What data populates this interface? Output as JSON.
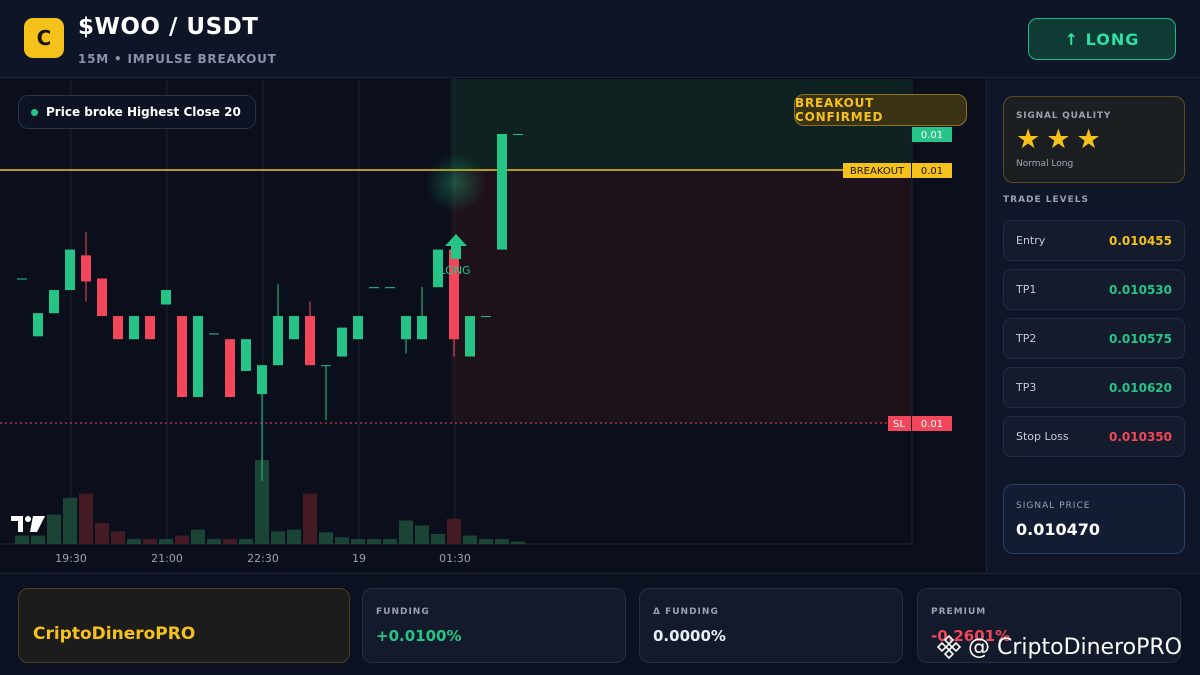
{
  "header": {
    "logo_letter": "C",
    "pair": "$WOO / USDT",
    "subtitle": "15M • IMPULSE BREAKOUT",
    "direction_icon": "arrow-up-icon",
    "direction_label": "↑ LONG"
  },
  "chart": {
    "info_pill": "Price broke Highest Close 20",
    "confirm_badge": "BREAKOUT CONFIRMED",
    "price_tags": {
      "current": "0.01",
      "breakout_label": "BREAKOUT",
      "breakout_value": "0.01",
      "sl_label": "SL",
      "sl_value": "0.01"
    },
    "signal_marker_label": "LONG",
    "x_ticks": [
      "19:30",
      "21:00",
      "22:30",
      "19",
      "01:30"
    ],
    "colors": {
      "up": "#26c486",
      "down": "#f2475a",
      "breakout": "#f5c21b",
      "stoploss": "#f2475a"
    }
  },
  "chart_data": {
    "type": "candlestick",
    "x_ticks": [
      "19:30",
      "21:00",
      "22:30",
      "19",
      "01:30"
    ],
    "levels": {
      "breakout": 0.01,
      "stop_loss": 0.01,
      "last": 0.01
    },
    "candles": [
      {
        "o": 0.5,
        "c": 0.5,
        "h": 0.5,
        "l": 0.5
      },
      {
        "o": 0.3,
        "c": 0.38,
        "h": 0.38,
        "l": 0.3
      },
      {
        "o": 0.38,
        "c": 0.46,
        "h": 0.46,
        "l": 0.38
      },
      {
        "o": 0.46,
        "c": 0.6,
        "h": 0.6,
        "l": 0.46
      },
      {
        "o": 0.58,
        "c": 0.49,
        "h": 0.66,
        "l": 0.42
      },
      {
        "o": 0.5,
        "c": 0.37,
        "h": 0.5,
        "l": 0.37
      },
      {
        "o": 0.37,
        "c": 0.29,
        "h": 0.37,
        "l": 0.29
      },
      {
        "o": 0.29,
        "c": 0.37,
        "h": 0.37,
        "l": 0.29
      },
      {
        "o": 0.37,
        "c": 0.29,
        "h": 0.37,
        "l": 0.29
      },
      {
        "o": 0.41,
        "c": 0.46,
        "h": 0.46,
        "l": 0.41
      },
      {
        "o": 0.37,
        "c": 0.09,
        "h": 0.37,
        "l": 0.09
      },
      {
        "o": 0.09,
        "c": 0.37,
        "h": 0.37,
        "l": 0.09
      },
      {
        "o": 0.31,
        "c": 0.31,
        "h": 0.31,
        "l": 0.31
      },
      {
        "o": 0.29,
        "c": 0.09,
        "h": 0.29,
        "l": 0.09
      },
      {
        "o": 0.18,
        "c": 0.29,
        "h": 0.29,
        "l": 0.18
      },
      {
        "o": 0.1,
        "c": 0.2,
        "h": 0.2,
        "l": -0.2
      },
      {
        "o": 0.2,
        "c": 0.37,
        "h": 0.48,
        "l": 0.2
      },
      {
        "o": 0.29,
        "c": 0.37,
        "h": 0.37,
        "l": 0.29
      },
      {
        "o": 0.37,
        "c": 0.2,
        "h": 0.42,
        "l": 0.2
      },
      {
        "o": 0.2,
        "c": 0.2,
        "h": 0.2,
        "l": 0.01
      },
      {
        "o": 0.23,
        "c": 0.33,
        "h": 0.33,
        "l": 0.23
      },
      {
        "o": 0.29,
        "c": 0.37,
        "h": 0.37,
        "l": 0.29
      },
      {
        "o": 0.47,
        "c": 0.47,
        "h": 0.47,
        "l": 0.47
      },
      {
        "o": 0.47,
        "c": 0.47,
        "h": 0.47,
        "l": 0.47
      },
      {
        "o": 0.29,
        "c": 0.37,
        "h": 0.37,
        "l": 0.24
      },
      {
        "o": 0.29,
        "c": 0.37,
        "h": 0.47,
        "l": 0.29
      },
      {
        "o": 0.47,
        "c": 0.6,
        "h": 0.6,
        "l": 0.47
      },
      {
        "o": 0.6,
        "c": 0.29,
        "h": 0.6,
        "l": 0.23
      },
      {
        "o": 0.23,
        "c": 0.37,
        "h": 0.37,
        "l": 0.23
      },
      {
        "o": 0.37,
        "c": 0.37,
        "h": 0.37,
        "l": 0.37
      },
      {
        "o": 0.6,
        "c": 1.0,
        "h": 1.0,
        "l": 0.6
      },
      {
        "o": 1.0,
        "c": 1.0,
        "h": 1.0,
        "l": 1.0
      }
    ],
    "volume": [
      0.1,
      0.1,
      0.35,
      0.55,
      0.6,
      0.25,
      0.15,
      0.06,
      0.06,
      0.06,
      0.1,
      0.17,
      0.06,
      0.06,
      0.06,
      1.0,
      0.15,
      0.17,
      0.6,
      0.14,
      0.08,
      0.06,
      0.06,
      0.06,
      0.28,
      0.22,
      0.12,
      0.3,
      0.1,
      0.06,
      0.06,
      0.03
    ]
  },
  "sidebar": {
    "quality_title": "SIGNAL QUALITY",
    "stars": [
      "★",
      "★",
      "★"
    ],
    "quality_sub": "Normal Long",
    "levels_title": "TRADE LEVELS",
    "levels": [
      {
        "label": "Entry",
        "value": "0.010455",
        "color": "#f5c21b"
      },
      {
        "label": "TP1",
        "value": "0.010530",
        "color": "#26c486"
      },
      {
        "label": "TP2",
        "value": "0.010575",
        "color": "#26c486"
      },
      {
        "label": "TP3",
        "value": "0.010620",
        "color": "#26c486"
      },
      {
        "label": "Stop Loss",
        "value": "0.010350",
        "color": "#f2475a"
      }
    ],
    "signal_price_title": "SIGNAL PRICE",
    "signal_price": "0.010470"
  },
  "footer": {
    "brand": "CriptoDineroPRO",
    "stats": [
      {
        "title": "FUNDING",
        "value": "+0.0100%",
        "color": "#26c486"
      },
      {
        "title": "Δ FUNDING",
        "value": "0.0000%",
        "color": "#e9edf5"
      },
      {
        "title": "PREMIUM",
        "value": "-0.2601%",
        "color": "#f2475a"
      }
    ],
    "watermark": "@ CriptoDineroPRO"
  }
}
